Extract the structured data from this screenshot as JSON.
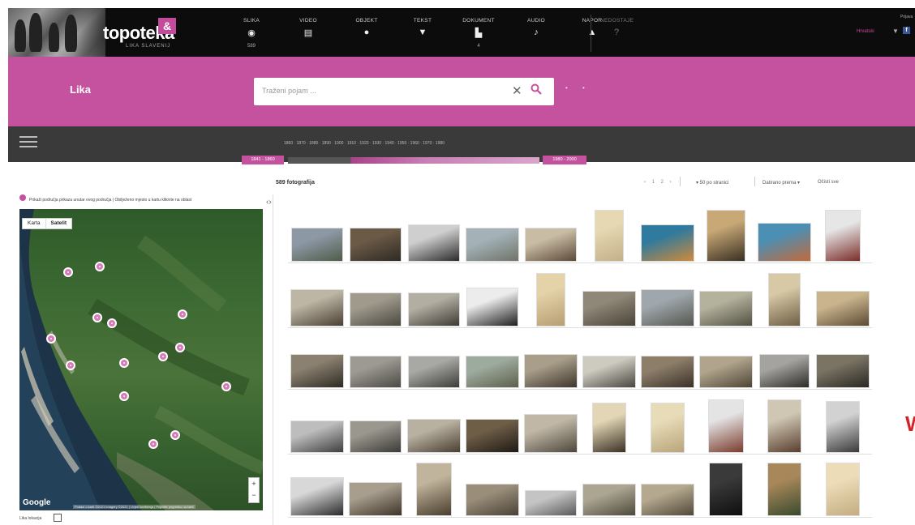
{
  "header": {
    "logo_text": "topoteka",
    "logo_badge": "&",
    "logo_subtitle": "LIKA SLAVENIJ",
    "nav": [
      {
        "label": "SLIKA",
        "icon": "circle-icon",
        "glyph": "◉",
        "count": "589"
      },
      {
        "label": "VIDEO",
        "icon": "film-icon",
        "glyph": "▤",
        "count": ""
      },
      {
        "label": "OBJEKT",
        "icon": "object-icon",
        "glyph": "●",
        "count": ""
      },
      {
        "label": "TEKST",
        "icon": "text-icon",
        "glyph": "▼",
        "count": ""
      },
      {
        "label": "DOKUMENT",
        "icon": "document-icon",
        "glyph": "▙",
        "count": "4"
      },
      {
        "label": "AUDIO",
        "icon": "audio-icon",
        "glyph": "♪",
        "count": ""
      },
      {
        "label": "NAPOR",
        "icon": "person-icon",
        "glyph": "▲",
        "count": ""
      },
      {
        "label": "NEDOSTAJE",
        "icon": "question-icon",
        "glyph": "?",
        "count": ""
      }
    ],
    "language": "Hrvatski",
    "login": "Prijava",
    "user_glyph": "▼",
    "facebook": "f"
  },
  "search": {
    "place": "Lika",
    "placeholder": "Traženi pojam ...",
    "clear_glyph": "✕",
    "search_glyph": "🔍",
    "extra": "• •"
  },
  "timeline": {
    "ticks": "1860 · 1870 · 1880 · 1890 · 1900 · 1910 · 1920 · 1930 · 1940 · 1950 · 1960 · 1970 · 1980",
    "from": "1841 - 1860",
    "to": "1980 - 2000"
  },
  "results": {
    "count": "589 fotografija",
    "pager": "‹ 1 2 ›",
    "per_page": "▾ 50 po stranici",
    "sort": "Datirano prema ▾",
    "clear": "Očisti sve"
  },
  "map": {
    "note": "Prikaži područja prikaza unutar ovog područja | Obilježeno mjesto u kartu kliknite na oblast",
    "toggle_map": "Karta",
    "toggle_sat": "Satelit",
    "zoom_in": "+",
    "zoom_out": "−",
    "provider": "Google",
    "copyright": "Podaci o karti ©2021 Imagery ©2021 | Uvjeti korištenja | Prijavite pogrešku na karti",
    "checkbox_label": "Lika lokacija",
    "markers": [
      {
        "x": 0.2,
        "y": 0.21
      },
      {
        "x": 0.33,
        "y": 0.19
      },
      {
        "x": 0.32,
        "y": 0.36
      },
      {
        "x": 0.38,
        "y": 0.38
      },
      {
        "x": 0.67,
        "y": 0.35
      },
      {
        "x": 0.13,
        "y": 0.43
      },
      {
        "x": 0.66,
        "y": 0.46
      },
      {
        "x": 0.59,
        "y": 0.49
      },
      {
        "x": 0.43,
        "y": 0.51
      },
      {
        "x": 0.21,
        "y": 0.52
      },
      {
        "x": 0.85,
        "y": 0.59
      },
      {
        "x": 0.43,
        "y": 0.62
      },
      {
        "x": 0.64,
        "y": 0.75
      },
      {
        "x": 0.55,
        "y": 0.78
      }
    ]
  },
  "gallery": {
    "rows": [
      [
        {
          "w": 62,
          "h": 40,
          "colors": [
            "#8d98a5",
            "#4f5c4a"
          ]
        },
        {
          "w": 62,
          "h": 40,
          "colors": [
            "#6b5a46",
            "#2e2a24"
          ]
        },
        {
          "w": 62,
          "h": 44,
          "colors": [
            "#cfcfcf",
            "#2b2b2b"
          ]
        },
        {
          "w": 64,
          "h": 40,
          "colors": [
            "#a4b2b8",
            "#6f7468"
          ]
        },
        {
          "w": 62,
          "h": 40,
          "colors": [
            "#c9bca4",
            "#5c4a3a"
          ]
        },
        {
          "w": 34,
          "h": 62,
          "colors": [
            "#e6d8b3",
            "#c2b088"
          ]
        },
        {
          "w": 64,
          "h": 44,
          "colors": [
            "#2f7a9e",
            "#d08a3a"
          ]
        },
        {
          "w": 46,
          "h": 62,
          "colors": [
            "#c7a876",
            "#3a2f22"
          ]
        },
        {
          "w": 64,
          "h": 46,
          "colors": [
            "#4c8fb5",
            "#c26a3b"
          ]
        },
        {
          "w": 42,
          "h": 62,
          "colors": [
            "#e6e6e6",
            "#7a2d28"
          ]
        }
      ],
      [
        {
          "w": 64,
          "h": 44,
          "colors": [
            "#bdb6a4",
            "#4a4034"
          ]
        },
        {
          "w": 62,
          "h": 40,
          "colors": [
            "#a09a8d",
            "#4b4840"
          ]
        },
        {
          "w": 62,
          "h": 40,
          "colors": [
            "#b3aea2",
            "#3e3b35"
          ]
        },
        {
          "w": 62,
          "h": 46,
          "colors": [
            "#ececec",
            "#1e1e1e"
          ]
        },
        {
          "w": 34,
          "h": 64,
          "colors": [
            "#e4d2a8",
            "#b79e72"
          ]
        },
        {
          "w": 64,
          "h": 42,
          "colors": [
            "#8f8778",
            "#4a4438"
          ]
        },
        {
          "w": 64,
          "h": 44,
          "colors": [
            "#9fa7ad",
            "#55574f"
          ]
        },
        {
          "w": 64,
          "h": 42,
          "colors": [
            "#b4b29c",
            "#525042"
          ]
        },
        {
          "w": 38,
          "h": 64,
          "colors": [
            "#d8c9a6",
            "#6e5e46"
          ]
        },
        {
          "w": 64,
          "h": 42,
          "colors": [
            "#c9b48d",
            "#5c4b33"
          ]
        }
      ],
      [
        {
          "w": 64,
          "h": 40,
          "colors": [
            "#8b8171",
            "#2f2a22"
          ]
        },
        {
          "w": 62,
          "h": 38,
          "colors": [
            "#9c9a92",
            "#4c4a44"
          ]
        },
        {
          "w": 62,
          "h": 38,
          "colors": [
            "#a8a8a4",
            "#3c3c38"
          ]
        },
        {
          "w": 64,
          "h": 38,
          "colors": [
            "#9daa9e",
            "#5d5f4a"
          ]
        },
        {
          "w": 64,
          "h": 40,
          "colors": [
            "#a99e8a",
            "#3e362c"
          ]
        },
        {
          "w": 64,
          "h": 38,
          "colors": [
            "#cdcac0",
            "#4a4740"
          ]
        },
        {
          "w": 64,
          "h": 38,
          "colors": [
            "#8d7e6a",
            "#3a3127"
          ]
        },
        {
          "w": 64,
          "h": 38,
          "colors": [
            "#b0a48c",
            "#4e4536"
          ]
        },
        {
          "w": 60,
          "h": 40,
          "colors": [
            "#a4a39f",
            "#2c2b28"
          ]
        },
        {
          "w": 64,
          "h": 40,
          "colors": [
            "#7a7464",
            "#2a2822"
          ]
        }
      ],
      [
        {
          "w": 64,
          "h": 38,
          "colors": [
            "#bdbdbd",
            "#3f3f3f"
          ]
        },
        {
          "w": 62,
          "h": 38,
          "colors": [
            "#9a978f",
            "#3d3b36"
          ]
        },
        {
          "w": 64,
          "h": 40,
          "colors": [
            "#b8b0a0",
            "#4a4032"
          ]
        },
        {
          "w": 64,
          "h": 40,
          "colors": [
            "#6e5e48",
            "#1f1a14"
          ]
        },
        {
          "w": 64,
          "h": 46,
          "colors": [
            "#c0b7a6",
            "#4d473c"
          ]
        },
        {
          "w": 40,
          "h": 60,
          "colors": [
            "#e2d6b6",
            "#3c3224"
          ]
        },
        {
          "w": 40,
          "h": 60,
          "colors": [
            "#e8dcb8",
            "#b8a47a"
          ]
        },
        {
          "w": 42,
          "h": 64,
          "colors": [
            "#e4e4e4",
            "#7a3c2e"
          ]
        },
        {
          "w": 40,
          "h": 64,
          "colors": [
            "#cfc7b4",
            "#5a3e2e"
          ]
        },
        {
          "w": 40,
          "h": 62,
          "colors": [
            "#d2d2d2",
            "#3a3a3a"
          ]
        }
      ],
      [
        {
          "w": 64,
          "h": 46,
          "colors": [
            "#d8d8d8",
            "#2a2a2a"
          ]
        },
        {
          "w": 64,
          "h": 40,
          "colors": [
            "#a79e8e",
            "#3e3428"
          ]
        },
        {
          "w": 42,
          "h": 64,
          "colors": [
            "#c0b49c",
            "#4a3e2e"
          ]
        },
        {
          "w": 64,
          "h": 38,
          "colors": [
            "#9a8e7a",
            "#4a4236"
          ]
        },
        {
          "w": 62,
          "h": 30,
          "colors": [
            "#c4c4c4",
            "#5a5a5a"
          ]
        },
        {
          "w": 64,
          "h": 38,
          "colors": [
            "#aba592",
            "#4e4a3c"
          ]
        },
        {
          "w": 64,
          "h": 38,
          "colors": [
            "#b4a88e",
            "#52483a"
          ]
        },
        {
          "w": 40,
          "h": 64,
          "colors": [
            "#3a3a3a",
            "#0e0e0e"
          ]
        },
        {
          "w": 40,
          "h": 64,
          "colors": [
            "#a8885a",
            "#3a4a2e"
          ]
        },
        {
          "w": 40,
          "h": 64,
          "colors": [
            "#ecdcb8",
            "#c4ac80"
          ]
        }
      ]
    ]
  },
  "watermark": "W"
}
